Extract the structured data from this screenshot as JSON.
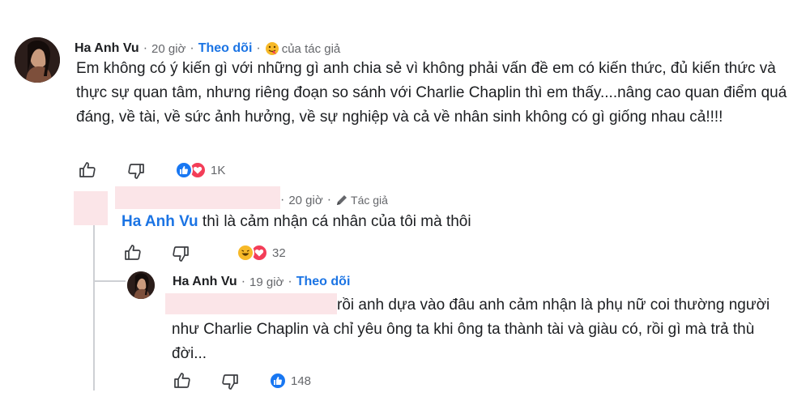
{
  "comments": [
    {
      "author": "Ha Anh Vu",
      "time": "20 giờ",
      "follow_label": "Theo dõi",
      "author_badge": "của tác giả",
      "text": "Em không có ý kiến gì với những gì anh chia sẻ vì không phải vấn đề em có kiến thức, đủ kiến thức và thực sự quan tâm, nhưng riêng đoạn so sánh với Charlie Chaplin thì em thấy....nâng cao quan điểm quá đáng, về tài, về sức ảnh hưởng, về sự nghiệp và cả về nhân sinh không có gì giống nhau cả!!!!",
      "reaction_count": "1K",
      "reactions": [
        "like",
        "love"
      ]
    },
    {
      "time": "20 giờ",
      "author_badge": "Tác giả",
      "mention": "Ha Anh Vu",
      "text": " thì là cảm nhận cá nhân của tôi mà thôi",
      "reaction_count": "32",
      "reactions": [
        "haha",
        "love"
      ]
    },
    {
      "author": "Ha Anh Vu",
      "time": "19 giờ",
      "follow_label": "Theo dõi",
      "text": "rồi anh dựa vào đâu anh cảm nhận là phụ nữ coi thường người như Charlie Chaplin và chỉ yêu ông ta khi ông ta thành tài và giàu có, rồi gì mà trả thù đời...",
      "reaction_count": "148",
      "reactions": [
        "like"
      ]
    }
  ],
  "colors": {
    "link_blue": "#1b74e4",
    "like_blue": "#1877f2",
    "love_red": "#f33e58",
    "haha_yellow": "#f7b928",
    "redaction_pink": "#fbe5e8"
  },
  "icons": [
    "like-icon",
    "dislike-icon",
    "pen-icon",
    "author-emoji-icon"
  ]
}
